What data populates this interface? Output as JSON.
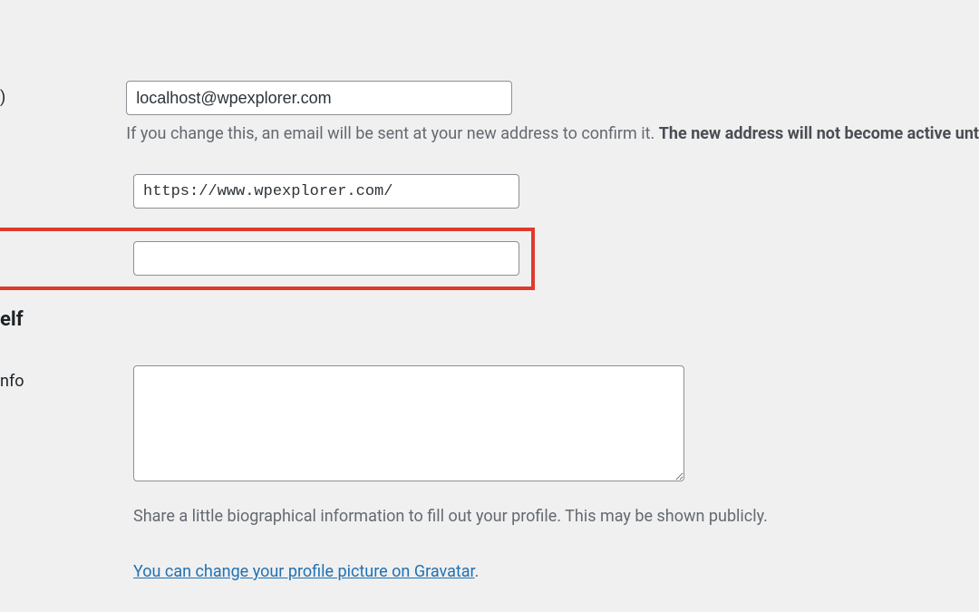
{
  "email": {
    "label_fragment": ")",
    "value": "localhost@wpexplorer.com",
    "description_prefix": "If you change this, an email will be sent at your new address to confirm it. ",
    "description_bold": "The new address will not become active unt"
  },
  "website": {
    "value": "https://www.wpexplorer.com/"
  },
  "custom_field": {
    "value": ""
  },
  "about": {
    "heading_fragment": "elf"
  },
  "bio": {
    "label_fragment": "nfo",
    "value": "",
    "description": "Share a little biographical information to fill out your profile. This may be shown publicly."
  },
  "gravatar": {
    "link_text": "You can change your profile picture on Gravatar",
    "period": "."
  }
}
